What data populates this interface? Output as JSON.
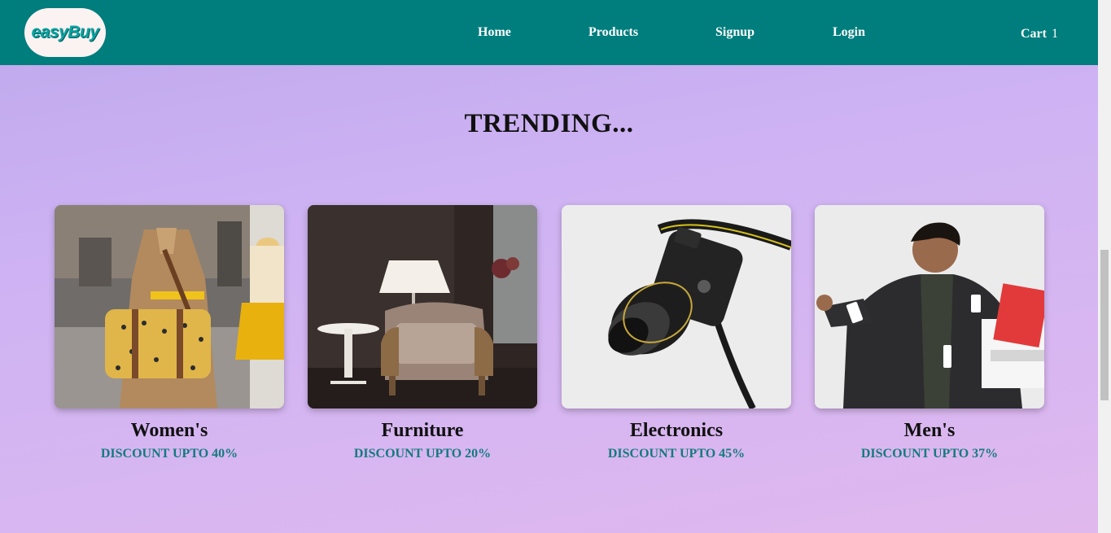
{
  "brand": {
    "logo_text": "easyBuy"
  },
  "nav": {
    "items": [
      {
        "label": "Home"
      },
      {
        "label": "Products"
      },
      {
        "label": "Signup"
      },
      {
        "label": "Login"
      }
    ],
    "cart_label": "Cart",
    "cart_count": "1"
  },
  "main": {
    "heading": "TRENDING...",
    "cards": [
      {
        "title": "Women's",
        "discount": "DISCOUNT UPTO 40%",
        "image": "womens-fashion-photo"
      },
      {
        "title": "Furniture",
        "discount": "DISCOUNT UPTO 20%",
        "image": "furniture-photo"
      },
      {
        "title": "Electronics",
        "discount": "DISCOUNT UPTO 45%",
        "image": "camera-photo"
      },
      {
        "title": "Men's",
        "discount": "DISCOUNT UPTO 37%",
        "image": "mens-fashion-photo"
      }
    ]
  },
  "colors": {
    "navbar": "#007d7d",
    "discount_text": "#137b7d",
    "logo_bg": "#fbf2f2"
  }
}
